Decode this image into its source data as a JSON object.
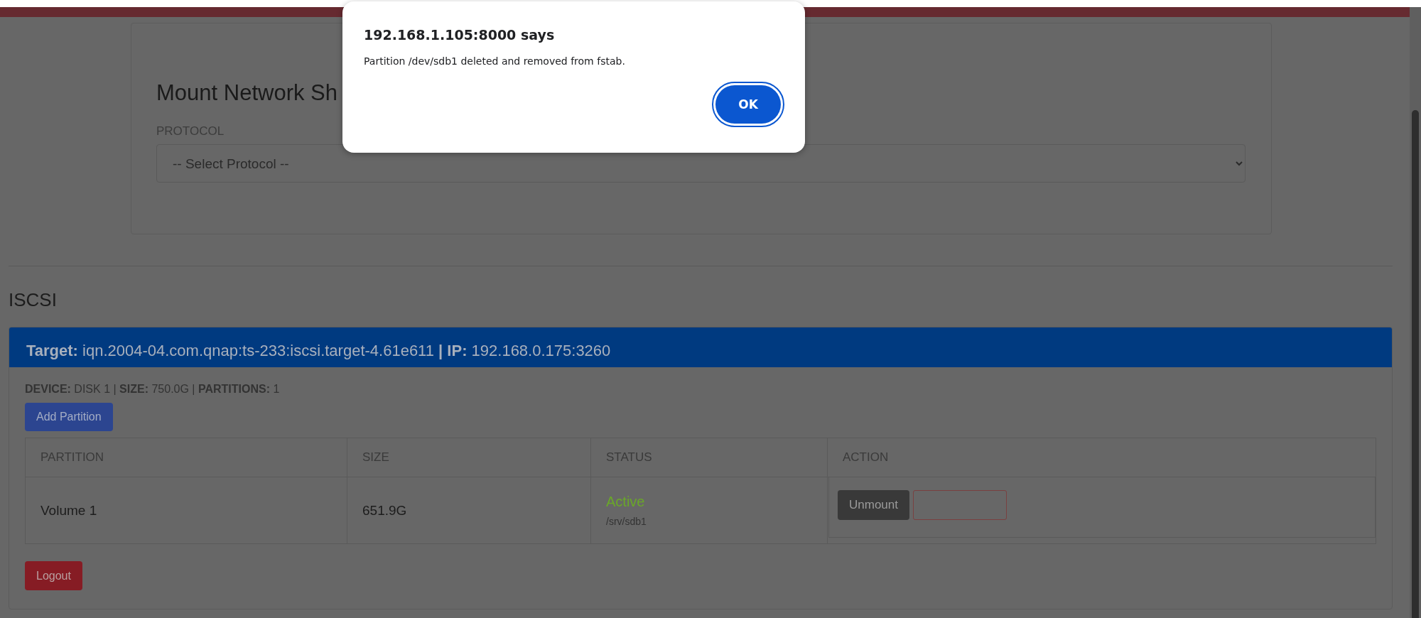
{
  "dialog": {
    "title": "192.168.1.105:8000 says",
    "message": "Partition /dev/sdb1 deleted and removed from fstab.",
    "ok_button": "OK"
  },
  "mount_form": {
    "title": "Mount Network Sh",
    "protocol_label": "PROTOCOL",
    "protocol_select": "-- Select Protocol --"
  },
  "iscsi": {
    "heading": "ISCSI",
    "target": {
      "target_label": "Target:",
      "target_value": "iqn.2004-04.com.qnap:ts-233:iscsi.target-4.61e611",
      "separator": "|",
      "ip_label": "IP:",
      "ip_value": "192.168.0.175:3260"
    },
    "device_info": "**DEVICE:** DISK 1 | **SIZE:** 750.0G | **PARTITIONS:** 1",
    "add_partition_button": "Add Partition",
    "table": {
      "columns": [
        "PARTITION",
        "SIZE",
        "STATUS",
        "ACTION"
      ],
      "rows": [
        {
          "partition": "Volume 1",
          "size": "651.9G",
          "status": "Active",
          "mount_point": "/srv/sdb1",
          "action_button": "Unmount"
        }
      ]
    },
    "logout_button": "Logout"
  }
}
